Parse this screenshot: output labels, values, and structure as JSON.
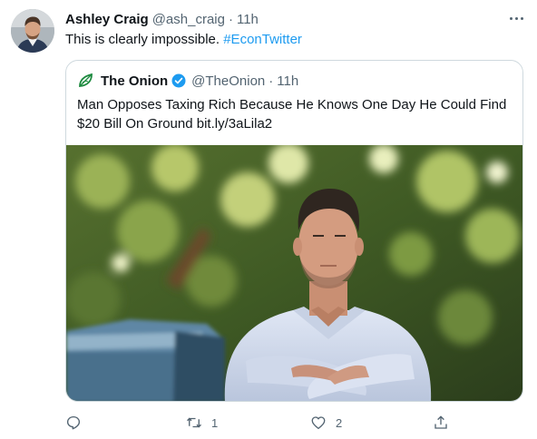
{
  "tweet": {
    "author_name": "Ashley Craig",
    "author_handle": "@ash_craig",
    "separator": "·",
    "time": "11h",
    "text": "This is clearly impossible. ",
    "hashtag": "#EconTwitter",
    "avatar_icon": "profile-photo"
  },
  "quoted": {
    "author_name": "The Onion",
    "author_handle": "@TheOnion",
    "separator": "·",
    "time": "11h",
    "text": "Man Opposes Taxing Rich Because He Knows One Day He Could Find $20 Bill On Ground ",
    "link": "bit.ly/3aLila2",
    "logo_icon": "onion-logo-icon",
    "verified_icon": "verified-badge-icon"
  },
  "actions": {
    "reply_icon": "reply-icon",
    "retweet_icon": "retweet-icon",
    "retweet_count": "1",
    "like_icon": "heart-icon",
    "like_count": "2",
    "share_icon": "share-icon"
  },
  "colors": {
    "link_blue": "#1d9bf0",
    "secondary_text": "#536471",
    "border": "#cfd9de",
    "onion_green": "#1d8a3f"
  }
}
